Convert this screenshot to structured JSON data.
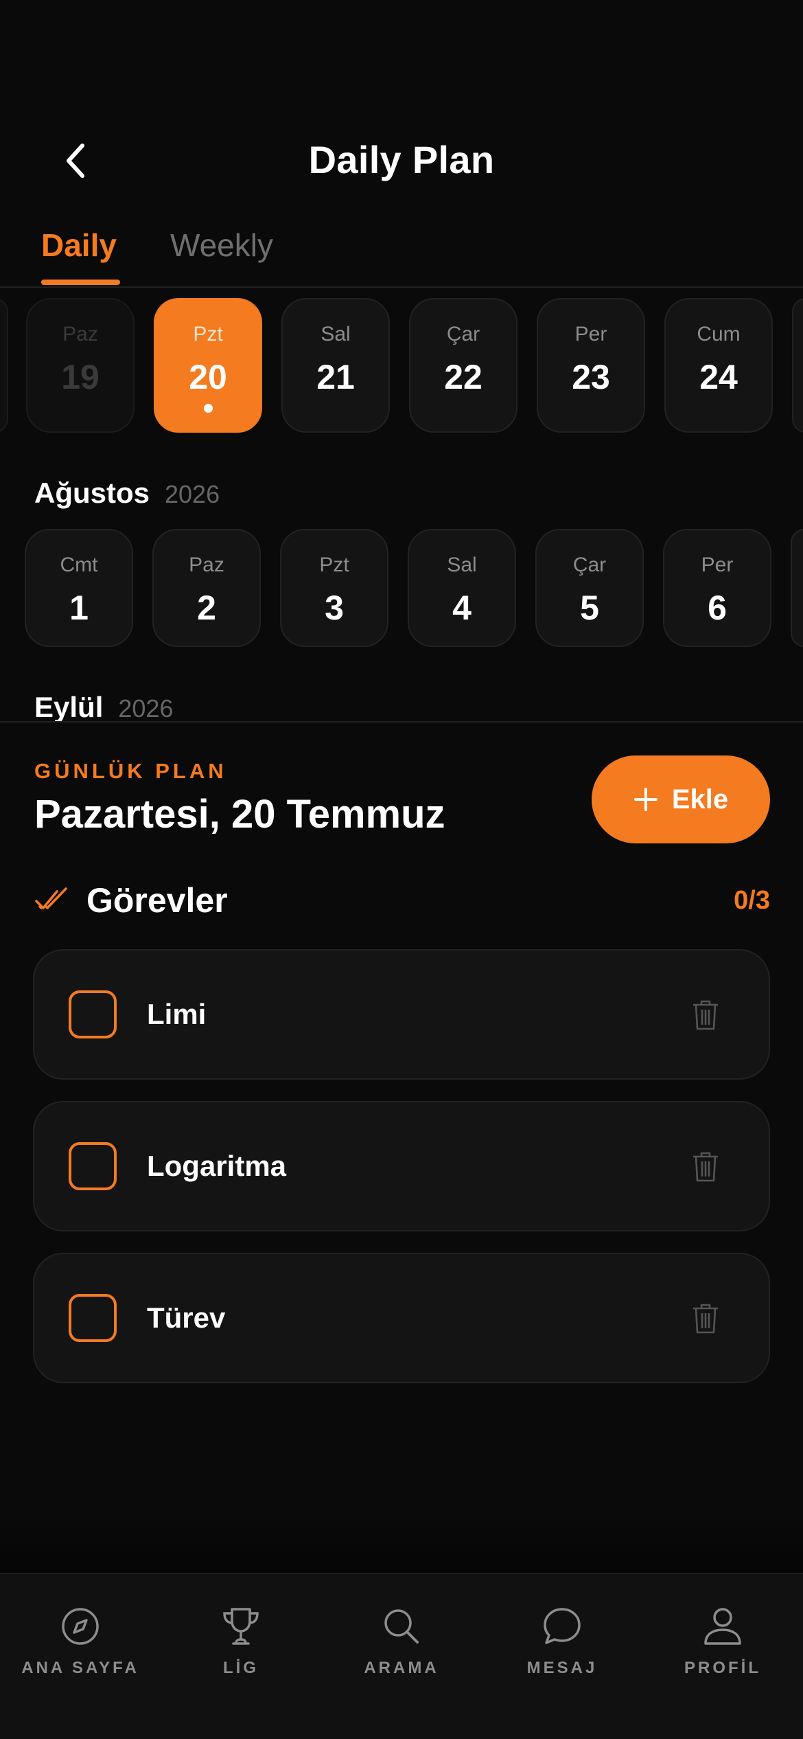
{
  "header": {
    "title": "Daily Plan"
  },
  "tabs": [
    {
      "label": "Daily"
    },
    {
      "label": "Weekly"
    }
  ],
  "week_strip": [
    {
      "day": "Paz",
      "date": "19"
    },
    {
      "day": "Pzt",
      "date": "20"
    },
    {
      "day": "Sal",
      "date": "21"
    },
    {
      "day": "Çar",
      "date": "22"
    },
    {
      "day": "Per",
      "date": "23"
    },
    {
      "day": "Cum",
      "date": "24"
    }
  ],
  "months": [
    {
      "name": "Ağustos",
      "year": "2026",
      "days": [
        {
          "day": "Cmt",
          "date": "1"
        },
        {
          "day": "Paz",
          "date": "2"
        },
        {
          "day": "Pzt",
          "date": "3"
        },
        {
          "day": "Sal",
          "date": "4"
        },
        {
          "day": "Çar",
          "date": "5"
        },
        {
          "day": "Per",
          "date": "6"
        }
      ]
    },
    {
      "name": "Eylül",
      "year": "2026"
    }
  ],
  "plan": {
    "eyebrow": "GÜNLÜK PLAN",
    "date": "Pazartesi, 20 Temmuz",
    "add_label": "Ekle"
  },
  "tasks_section": {
    "title": "Görevler",
    "count": "0/3"
  },
  "tasks": [
    {
      "label": "Limi",
      "done": false
    },
    {
      "label": "Logaritma",
      "done": false
    },
    {
      "label": "Türev",
      "done": false
    }
  ],
  "nav": [
    {
      "label": "ANA SAYFA",
      "icon": "compass-icon"
    },
    {
      "label": "LİG",
      "icon": "trophy-icon"
    },
    {
      "label": "ARAMA",
      "icon": "search-icon"
    },
    {
      "label": "MESAJ",
      "icon": "chat-icon"
    },
    {
      "label": "PROFİL",
      "icon": "user-icon"
    }
  ],
  "colors": {
    "accent": "#f47b20",
    "background": "#0a0a0a",
    "card": "#141414"
  }
}
